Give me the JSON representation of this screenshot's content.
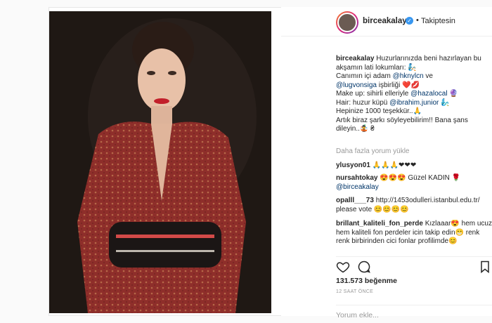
{
  "header": {
    "username": "birceakalay",
    "verified_icon": "✓",
    "dot": "•",
    "follow_label": "Takiptesin"
  },
  "caption": {
    "user": "birceakalay",
    "text1": "Huzurlarınızda beni hazırlayan bu akşamın lati lokumları: 🧞",
    "text2": "Canımın içi adam ",
    "mention1": "@hknylcn",
    "and": " ve ",
    "mention2": "@lugvonsiga",
    "text3": " işbirliği ❤️💋",
    "text4": "Make up: sihirli elleriyle ",
    "mention3": "@hazalocal",
    "text4b": " 🔮",
    "text5": "Hair: huzur küpü ",
    "mention4": "@ibrahim.junior",
    "text5b": " 🧞‍♂️",
    "text6": "Hepinize 1000 teşekkür..🙏",
    "text7": "Artık biraz şarkı söyleyebilirim!! Bana şans dileyin..🤹 ₴"
  },
  "more_comments": "Daha fazla yorum yükle",
  "comments": [
    {
      "user": "ylusyon01",
      "text": "🙏🙏🙏❤❤❤"
    },
    {
      "user": "nursahtokay",
      "text": "😍😍😍 Güzel KADIN 🌹",
      "mention": "@birceakalay"
    },
    {
      "user": "opalll___73",
      "text": "http://1453odulleri.istanbul.edu.tr/ please vote 😊😊😊😊"
    },
    {
      "user": "brillant_kaliteli_fon_perde",
      "text": "Kızlaaar😍 hem ucuz hem kaliteli fon perdeler icin takip edin😁 renk renk birbirinden cici fonlar profilimde😊"
    }
  ],
  "likes": "131.573 beğenme",
  "time": "12 SAAT ÖNCE",
  "add_comment_placeholder": "Yorum ekle..."
}
